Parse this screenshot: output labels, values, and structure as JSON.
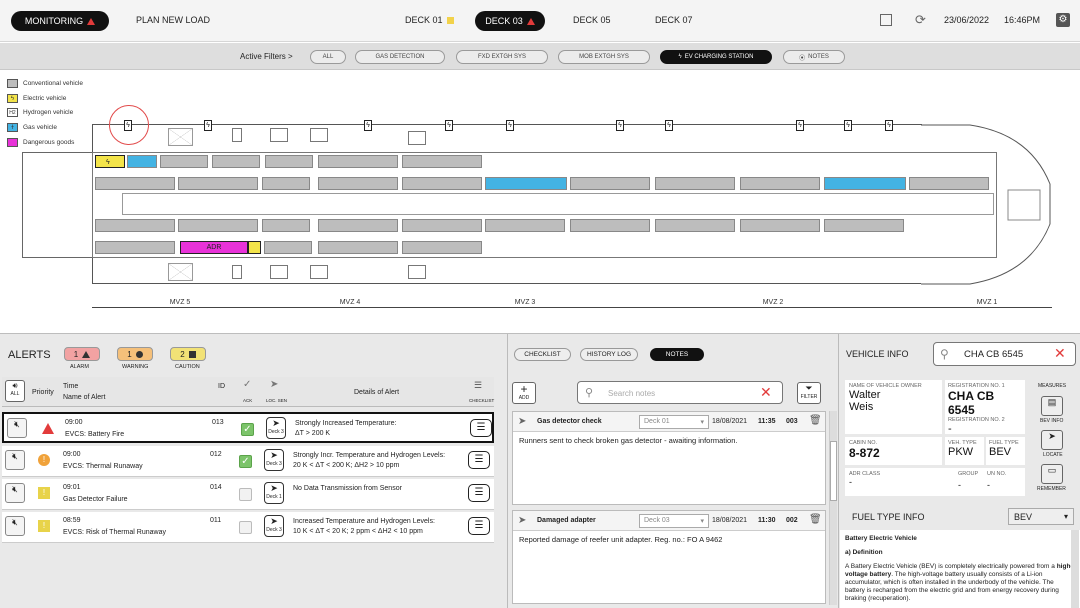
{
  "topbar": {
    "monitoring": "MONITORING",
    "plan_new_load": "PLAN NEW LOAD",
    "decks": [
      "DECK 01",
      "DECK 03",
      "DECK 05",
      "DECK 07"
    ],
    "date": "23/06/2022",
    "time": "16:46PM"
  },
  "filters": {
    "label": "Active Filters >",
    "items": [
      "ALL",
      "GAS DETECTION",
      "FXD EXTGH SYS",
      "MOB EXTGH SYS",
      "EV CHARGING STATION",
      "NOTES"
    ]
  },
  "legend": [
    "Conventional vehicle",
    "Electric vehicle",
    "Hydrogen vehicle",
    "Gas vehicle",
    "Dangerous goods"
  ],
  "legend_colors": [
    "#bdbdbd",
    "#f3e44a",
    "#ffffff",
    "#43b3e3",
    "#e832d8"
  ],
  "deck": {
    "adr_label": "ADR",
    "h2_label": "H2",
    "mvz": [
      "MVZ 5",
      "MVZ 4",
      "MVZ 3",
      "MVZ 2",
      "MVZ 1"
    ]
  },
  "alerts": {
    "title": "ALERTS",
    "badges": [
      {
        "count": "1",
        "label": "ALARM",
        "color": "#f2a2a2"
      },
      {
        "count": "1",
        "label": "WARNING",
        "color": "#f5c07a"
      },
      {
        "count": "2",
        "label": "CAUTION",
        "color": "#f2e276"
      }
    ],
    "headers": {
      "all": "ALL",
      "priority": "Priority",
      "time": "Time",
      "name": "Name of Alert",
      "id": "ID",
      "ack": "ACK",
      "loc": "LOC. SEN",
      "details": "Details of Alert",
      "checklist": "CHECKLIST"
    },
    "rows": [
      {
        "time": "09:00",
        "name": "EVCS: Battery Fire",
        "id": "013",
        "ack": true,
        "deck": "Deck 3",
        "details1": "Strongly Increased Temperature:",
        "details2": "ΔT > 200 K",
        "priority": "alarm"
      },
      {
        "time": "09:00",
        "name": "EVCS: Thermal Runaway",
        "id": "012",
        "ack": true,
        "deck": "Deck 3",
        "details1": "Strongly Incr. Temperature and Hydrogen Levels:",
        "details2": "20 K < ΔT < 200 K; ΔH2 > 10 ppm",
        "priority": "warning"
      },
      {
        "time": "09:01",
        "name": "Gas Detector Failure",
        "id": "014",
        "ack": false,
        "deck": "Deck 1",
        "details1": "No Data Transmission from Sensor",
        "details2": "",
        "priority": "caution"
      },
      {
        "time": "08:59",
        "name": "EVCS: Risk of Thermal Runaway",
        "id": "011",
        "ack": false,
        "deck": "Deck 3",
        "details1": "Increased Temperature and Hydrogen Levels:",
        "details2": "10 K < ΔT < 20 K; 2 ppm < ΔH2 < 10 ppm",
        "priority": "caution"
      }
    ]
  },
  "notes_panel": {
    "tabs": [
      "CHECKLIST",
      "HISTORY LOG",
      "NOTES"
    ],
    "add": "ADD",
    "search_placeholder": "Search notes",
    "filter": "FILTER",
    "notes": [
      {
        "title": "Gas detector check",
        "deck": "Deck 01",
        "date": "18/08/2021",
        "time": "11:35",
        "id": "003",
        "body": "Runners sent to check broken gas detector - awaiting information."
      },
      {
        "title": "Damaged adapter",
        "deck": "Deck 03",
        "date": "18/08/2021",
        "time": "11:30",
        "id": "002",
        "body": "Reported damage of reefer unit adapter. Reg. no.: FO A 9462"
      }
    ]
  },
  "vehicle": {
    "title": "VEHICLE INFO",
    "search_value": "CHA CB 6545",
    "owner_label": "NAME OF VEHICLE OWNER",
    "owner_first": "Walter",
    "owner_last": "Weis",
    "reg1_label": "REGISTRATION NO. 1",
    "reg1": "CHA CB 6545",
    "reg2_label": "REGISTRATION NO. 2",
    "reg2": "-",
    "cabin_label": "CABIN NO.",
    "cabin": "8-872",
    "vehtype_label": "VEH. TYPE",
    "vehtype": "PKW",
    "fueltype_label": "FUEL TYPE",
    "fueltype": "BEV",
    "adr_label": "ADR CLASS",
    "adr": "-",
    "group_label": "GROUP",
    "group": "-",
    "un_label": "UN NO.",
    "un": "-",
    "side": [
      "MEASURES",
      "BEV INFO",
      "LOCATE",
      "REMEMBER"
    ],
    "fuel_title": "FUEL TYPE INFO",
    "fuel_select": "BEV",
    "fuel_heading": "Battery Electric Vehicle",
    "fuel_sub": "a) Definition",
    "fuel_p1": "A Battery Electric Vehicle (BEV) is completely electrically powered from a",
    "fuel_bold": "high-voltage battery",
    "fuel_p2": ". The high-voltage battery usually consists of a Li-ion accumulator, which is often installed in the underbody of the vehicle. The battery is recharged from the electric grid and from energy recovery during braking (recuperation)."
  }
}
